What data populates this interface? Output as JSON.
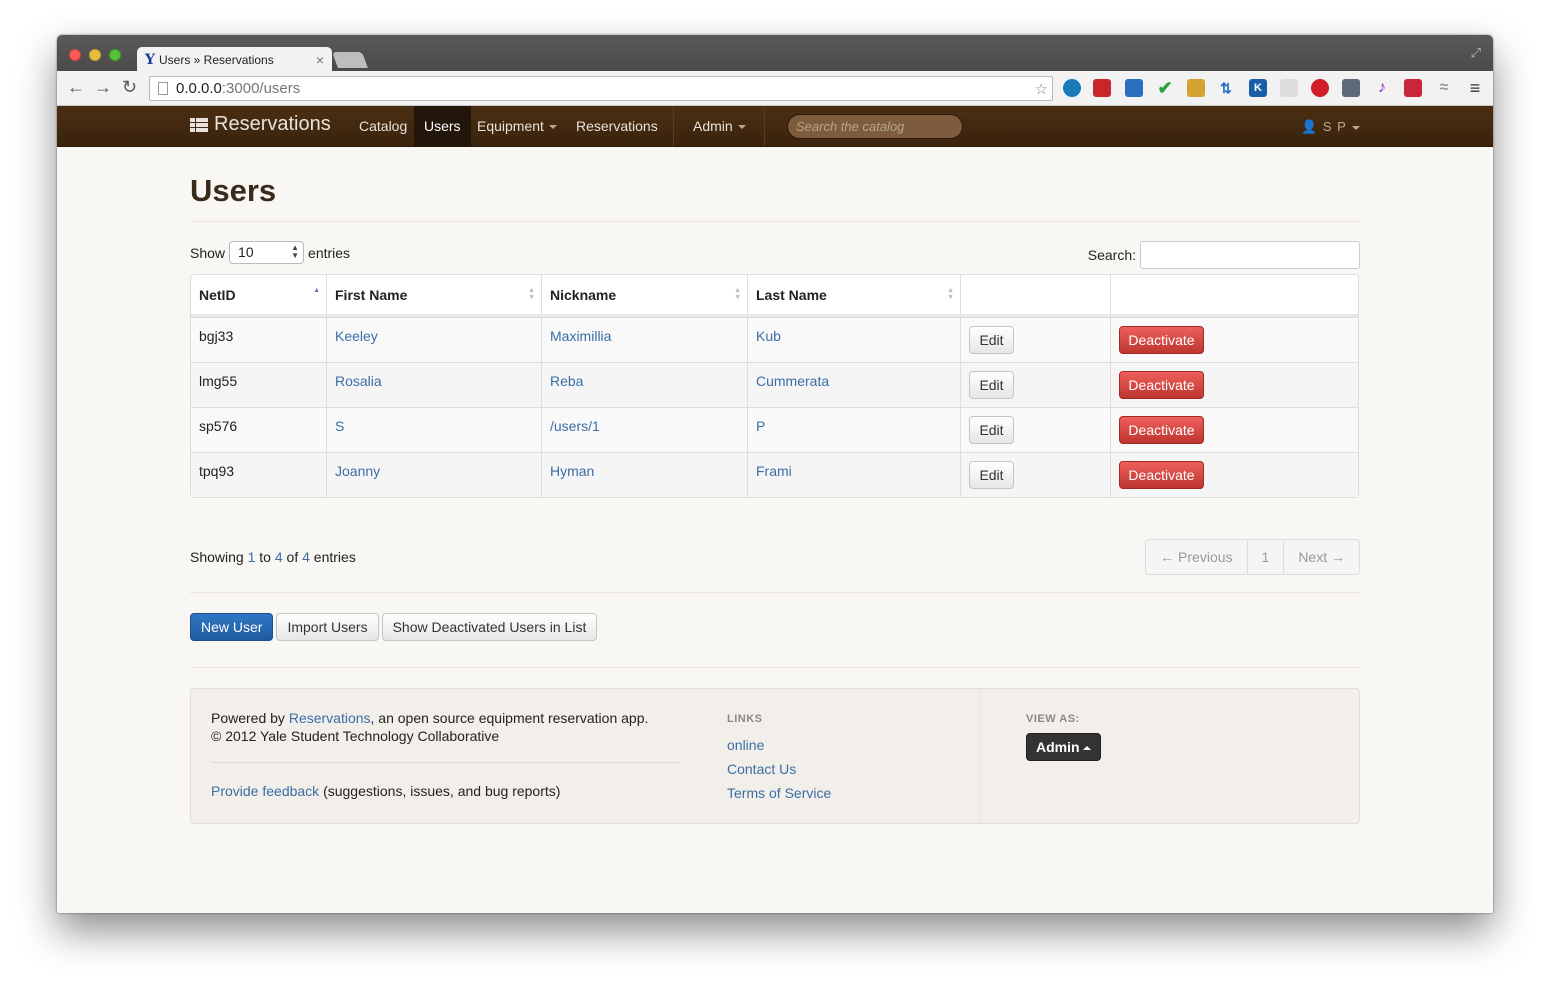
{
  "browser": {
    "tab_title": "Users » Reservations",
    "tab_favicon": "Y",
    "url_host": "0.0.0.0",
    "url_path": ":3000/users"
  },
  "nav": {
    "brand": "Reservations",
    "items": [
      "Catalog",
      "Users",
      "Equipment",
      "Reservations",
      "Admin"
    ],
    "search_placeholder": "Search the catalog",
    "user": "S P"
  },
  "page": {
    "title": "Users",
    "show_label": "Show",
    "entries_value": "10",
    "entries_label": "entries",
    "search_label": "Search:"
  },
  "table": {
    "columns": [
      "NetID",
      "First Name",
      "Nickname",
      "Last Name",
      "",
      ""
    ],
    "rows": [
      {
        "netid": "bgj33",
        "first": "Keeley",
        "nickname": "Maximillia",
        "last": "Kub",
        "edit": "Edit",
        "deactivate": "Deactivate"
      },
      {
        "netid": "lmg55",
        "first": "Rosalia",
        "nickname": "Reba",
        "last": "Cummerata",
        "edit": "Edit",
        "deactivate": "Deactivate"
      },
      {
        "netid": "sp576",
        "first": "S",
        "nickname": "/users/1",
        "last": "P",
        "edit": "Edit",
        "deactivate": "Deactivate"
      },
      {
        "netid": "tpq93",
        "first": "Joanny",
        "nickname": "Hyman",
        "last": "Frami",
        "edit": "Edit",
        "deactivate": "Deactivate"
      }
    ]
  },
  "pagination": {
    "info_prefix": "Showing ",
    "info_start": "1",
    "info_mid1": " to ",
    "info_end": "4",
    "info_mid2": " of ",
    "info_total": "4",
    "info_suffix": " entries",
    "previous": "← Previous",
    "page": "1",
    "next": "Next →"
  },
  "actions": {
    "new_user": "New User",
    "import_users": "Import Users",
    "show_deactivated": "Show Deactivated Users in List"
  },
  "footer": {
    "powered_prefix": "Powered by ",
    "powered_link": "Reservations",
    "powered_suffix": ", an open source equipment reservation app.",
    "copyright": "© 2012 Yale Student Technology Collaborative",
    "feedback_link": "Provide feedback",
    "feedback_suffix": " (suggestions, issues, and bug reports)",
    "links_heading": "LINKS",
    "links": [
      "online",
      "Contact Us",
      "Terms of Service"
    ],
    "view_as_heading": "VIEW AS:",
    "view_as_value": "Admin"
  },
  "colors": {
    "navbar": "#3a230d",
    "link": "#3a6ea5",
    "danger": "#d9534f",
    "primary": "#2a6ab5"
  }
}
